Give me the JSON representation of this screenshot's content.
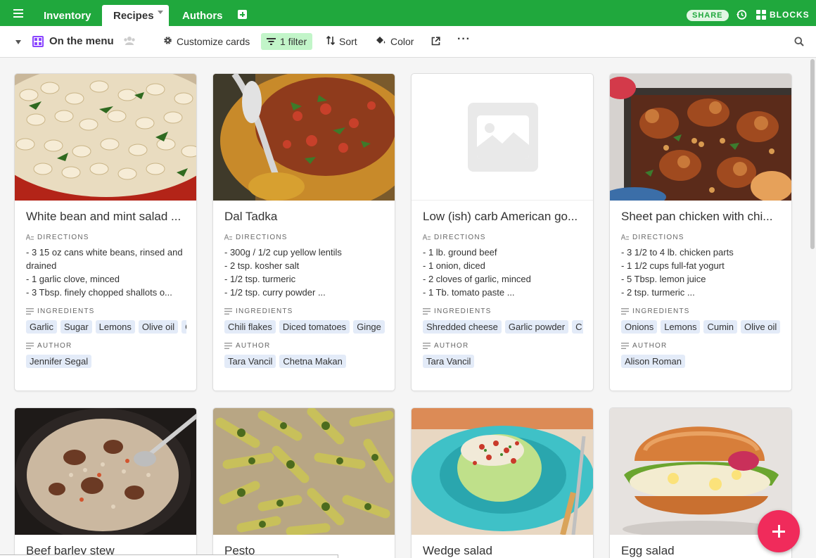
{
  "tabs": [
    {
      "label": "Inventory",
      "active": false
    },
    {
      "label": "Recipes",
      "active": true
    },
    {
      "label": "Authors",
      "active": false
    }
  ],
  "topbar": {
    "share_label": "SHARE",
    "blocks_label": "BLOCKS",
    "accent": "#20a83d"
  },
  "view": {
    "name": "On the menu",
    "customize_label": "Customize cards",
    "filter_label": "1 filter",
    "sort_label": "Sort",
    "color_label": "Color",
    "more_label": "···"
  },
  "labels": {
    "directions": "DIRECTIONS",
    "ingredients": "INGREDIENTS",
    "author": "AUTHOR"
  },
  "cards": [
    {
      "title": "White bean and mint salad ...",
      "directions": "- 3 15 oz cans white beans, rinsed and drained\n- 1 garlic clove, minced\n- 3 Tbsp. finely chopped shallots o...",
      "ingredients": [
        "Garlic",
        "Sugar",
        "Lemons",
        "Olive oil",
        "C"
      ],
      "authors": [
        "Jennifer Segal"
      ]
    },
    {
      "title": "Dal Tadka",
      "directions": "- 300g / 1/2 cup yellow lentils\n- 2 tsp. kosher salt\n- 1/2 tsp. turmeric\n- 1/2 tsp. curry powder   ...",
      "ingredients": [
        "Chili flakes",
        "Diced tomatoes",
        "Ginge"
      ],
      "authors": [
        "Tara Vancil",
        "Chetna Makan"
      ]
    },
    {
      "title": "Low (ish) carb American go...",
      "directions": "- 1 lb. ground beef\n- 1 onion, diced\n- 2 cloves of garlic, minced\n- 1 Tb. tomato paste      ...",
      "ingredients": [
        "Shredded cheese",
        "Garlic powder",
        "C"
      ],
      "authors": [
        "Tara Vancil"
      ]
    },
    {
      "title": "Sheet pan chicken with chi...",
      "directions": "- 3 1/2 to 4 lb. chicken parts\n- 1 1/2 cups full-fat yogurt\n- 5 Tbsp. lemon juice\n- 2 tsp. turmeric       ...",
      "ingredients": [
        "Onions",
        "Lemons",
        "Cumin",
        "Olive oil"
      ],
      "authors": [
        "Alison Roman"
      ]
    },
    {
      "title": "Beef barley stew"
    },
    {
      "title": "Pesto"
    },
    {
      "title": "Wedge salad"
    },
    {
      "title": "Egg salad"
    }
  ]
}
